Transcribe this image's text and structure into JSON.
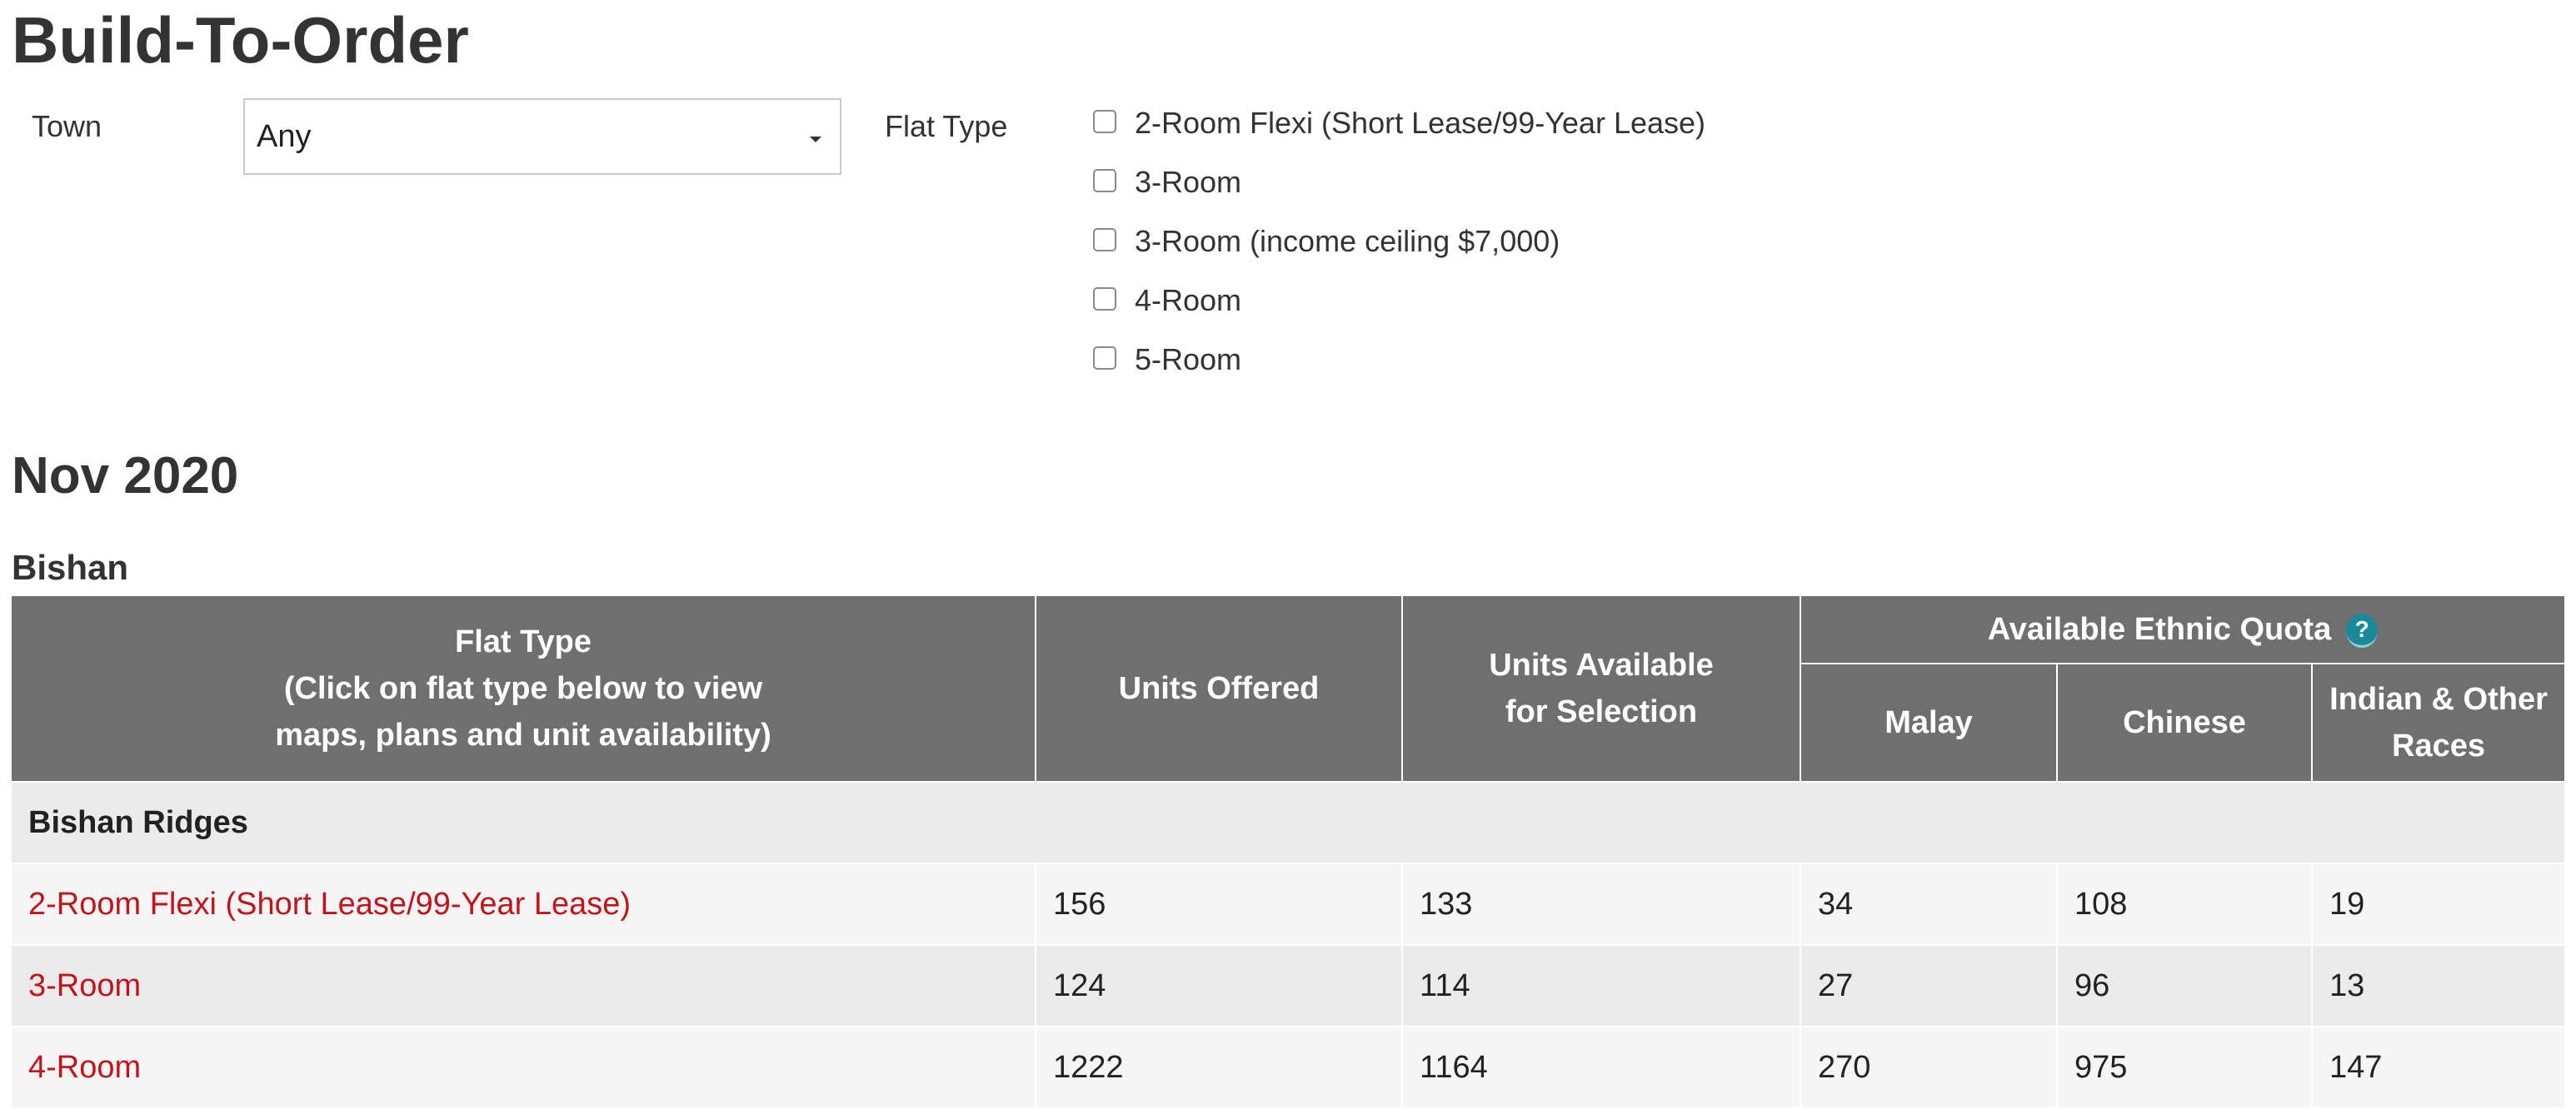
{
  "page": {
    "title": "Build-To-Order"
  },
  "filters": {
    "town_label": "Town",
    "town_value": "Any",
    "flat_type_label": "Flat Type",
    "flat_type_options": [
      "2-Room Flexi (Short Lease/99-Year Lease)",
      "3-Room",
      "3-Room (income ceiling $7,000)",
      "4-Room",
      "5-Room"
    ]
  },
  "launch": {
    "title": "Nov 2020"
  },
  "town": {
    "name": "Bishan"
  },
  "table": {
    "headers": {
      "flat_type": "Flat Type\n(Click on flat type below to view\nmaps, plans and unit availability)",
      "units_offered": "Units Offered",
      "units_available": "Units Available\nfor Selection",
      "ethnic_quota": "Available Ethnic Quota",
      "help_icon": "?",
      "malay": "Malay",
      "chinese": "Chinese",
      "indian_other": "Indian & Other\nRaces"
    },
    "project": "Bishan Ridges",
    "rows": [
      {
        "flat_type": "2-Room Flexi (Short Lease/99-Year Lease)",
        "units_offered": "156",
        "units_available": "133",
        "malay": "34",
        "chinese": "108",
        "indian_other": "19"
      },
      {
        "flat_type": "3-Room",
        "units_offered": "124",
        "units_available": "114",
        "malay": "27",
        "chinese": "96",
        "indian_other": "13"
      },
      {
        "flat_type": "4-Room",
        "units_offered": "1222",
        "units_available": "1164",
        "malay": "270",
        "chinese": "975",
        "indian_other": "147"
      }
    ]
  },
  "colors": {
    "header_bg": "#6f6f6f",
    "link": "#c0131c",
    "row_light": "#f5f5f5",
    "row_dark": "#ebebeb",
    "help_icon": "#1a8a9a"
  }
}
